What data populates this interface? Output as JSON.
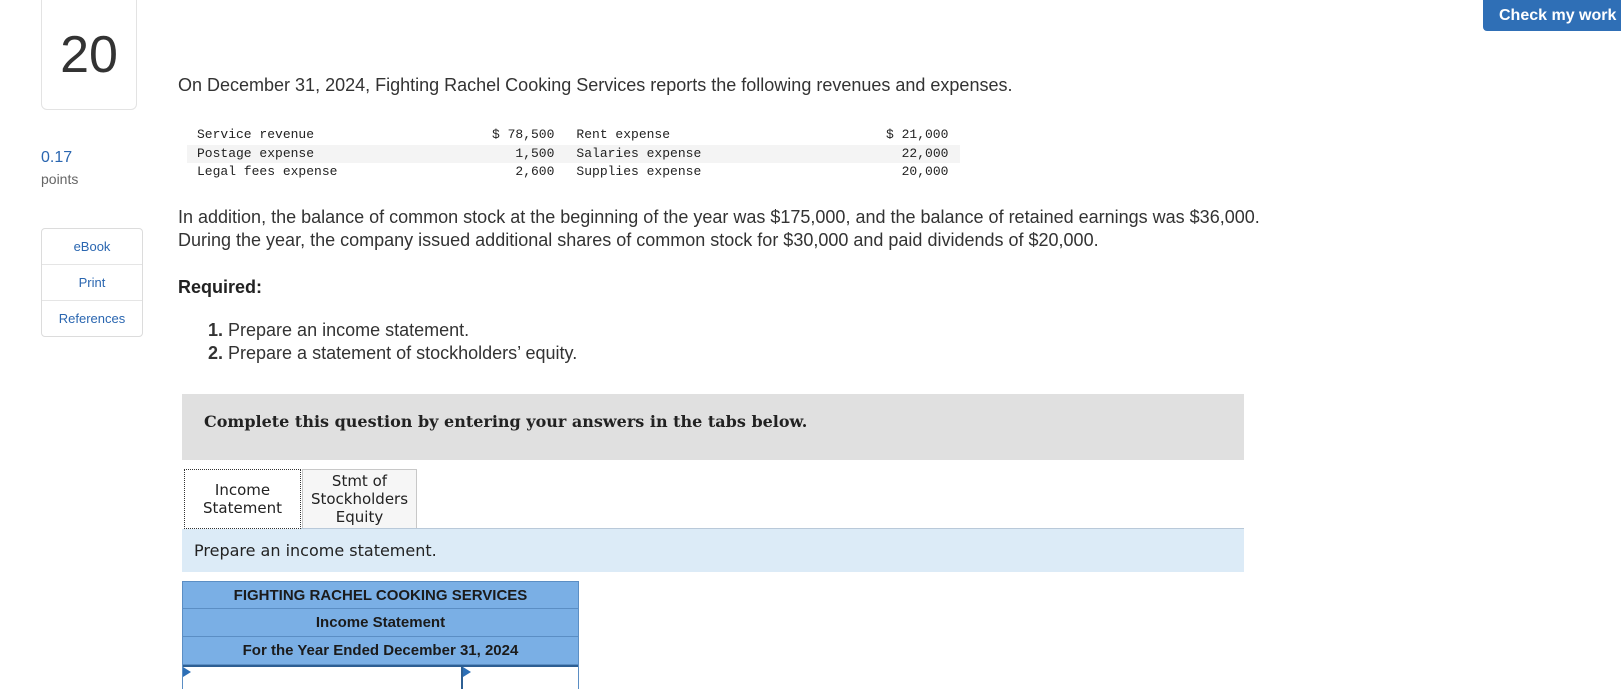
{
  "question": {
    "number": "20",
    "points_value": "0.17",
    "points_label": "points"
  },
  "resources": [
    "eBook",
    "Print",
    "References"
  ],
  "check_button": "Check my work",
  "intro": "On December 31, 2024, Fighting Rachel Cooking Services reports the following revenues and expenses.",
  "accounts": [
    {
      "label1": "Service revenue",
      "amount1": "$ 78,500",
      "label2": "Rent expense",
      "amount2": "$ 21,000"
    },
    {
      "label1": "Postage expense",
      "amount1": "1,500",
      "label2": "Salaries expense",
      "amount2": "22,000"
    },
    {
      "label1": "Legal fees expense",
      "amount1": "2,600",
      "label2": "Supplies expense",
      "amount2": "20,000"
    }
  ],
  "addition": "In addition, the balance of common stock at the beginning of the year was $175,000, and the balance of retained earnings was $36,000. During the year, the company issued additional shares of common stock for $30,000 and paid dividends of $20,000.",
  "required_label": "Required:",
  "requirements": [
    {
      "num": "1.",
      "text": " Prepare an income statement."
    },
    {
      "num": "2.",
      "text": " Prepare a statement of stockholders’ equity."
    }
  ],
  "complete_prompt": "Complete this question by entering your answers in the tabs below.",
  "tabs": [
    {
      "line1": "Income",
      "line2": "Statement"
    },
    {
      "line1": "Stmt of",
      "line2": "Stockholders",
      "line3": "Equity"
    }
  ],
  "tab_instruction": "Prepare an income statement.",
  "statement": {
    "company": "FIGHTING RACHEL COOKING SERVICES",
    "title": "Income Statement",
    "period": "For the Year Ended December 31, 2024"
  }
}
